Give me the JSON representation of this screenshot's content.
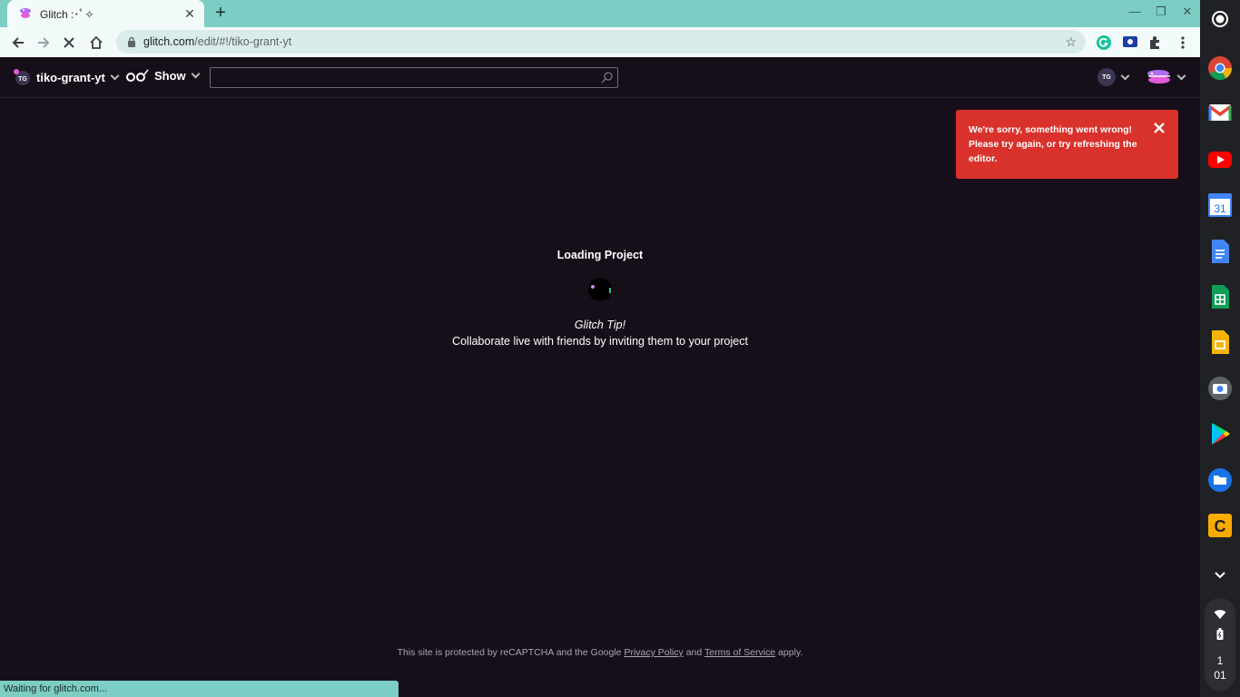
{
  "browser": {
    "tab_title": "Glitch :･ﾟ✧",
    "url_host": "glitch.com",
    "url_path": "/edit/#!/tiko-grant-yt",
    "status_text": "Waiting for glitch.com..."
  },
  "app": {
    "project_name": "tiko-grant-yt",
    "show_label": "Show",
    "search": {
      "value": "",
      "placeholder": ""
    },
    "user_initials": "TG"
  },
  "toast": {
    "message": "We're sorry, something went wrong! Please try again, or try refreshing the editor."
  },
  "loading": {
    "title": "Loading Project",
    "tip_title": "Glitch Tip!",
    "tip_body": "Collaborate live with friends by inviting them to your project"
  },
  "footer": {
    "prefix": "This site is protected by reCAPTCHA and the Google",
    "privacy_label": "Privacy Policy",
    "and": "and",
    "terms_label": "Terms of Service",
    "suffix": "apply."
  },
  "shelf": {
    "calendar_day": "31",
    "clock_hour": "1",
    "clock_minute": "01"
  },
  "colors": {
    "tabstrip": "#7ccdc4",
    "app_bg": "#160f1a",
    "toast_bg": "#d9312b"
  }
}
